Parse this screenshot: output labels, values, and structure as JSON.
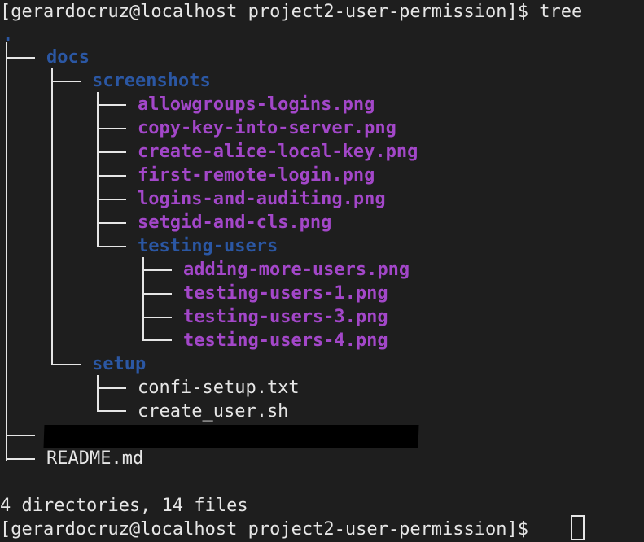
{
  "terminal": {
    "prompt_line": "[gerardocruz@localhost project2-user-permission]$ tree",
    "root": ".",
    "tree": {
      "docs": "docs",
      "screenshots": "screenshots",
      "screenshot_files": [
        "allowgroups-logins.png",
        "copy-key-into-server.png",
        "create-alice-local-key.png",
        "first-remote-login.png",
        "logins-and-auditing.png",
        "setgid-and-cls.png"
      ],
      "testing_users": "testing-users",
      "testing_users_files": [
        "adding-more-users.png",
        "testing-users-1.png",
        "testing-users-3.png",
        "testing-users-4.png"
      ],
      "setup": "setup",
      "setup_files": [
        "confi-setup.txt",
        "create_user.sh"
      ],
      "readme": "README.md"
    },
    "summary": "4 directories, 14 files",
    "final_prompt": "[gerardocruz@localhost project2-user-permission]$ "
  },
  "colors": {
    "background": "#1e1e1e",
    "text": "#e6e6e6",
    "directory": "#2b57a3",
    "image_file": "#a347c9",
    "redaction": "#000000"
  }
}
